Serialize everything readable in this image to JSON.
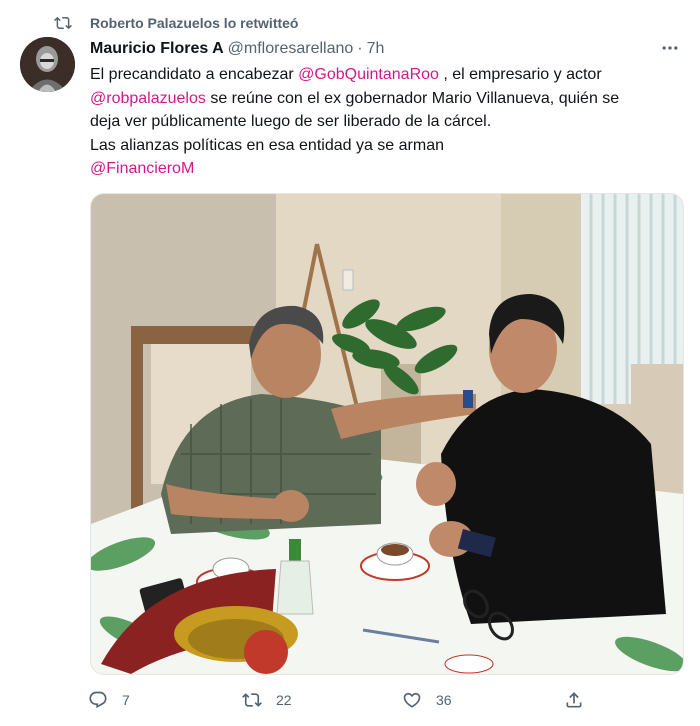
{
  "retweet": {
    "text": "Roberto Palazuelos lo retwitteó",
    "icon": "retweet-icon"
  },
  "author": {
    "name": "Mauricio Flores A",
    "handle": "@mfloresarellano",
    "separator": "·",
    "time": "7h"
  },
  "more_icon": "more-options-icon",
  "body": {
    "l1_text": "El precandidato a encabezar ",
    "l1_mention": "@GobQuintanaRoo",
    "l1_rest": " , el empresario y actor",
    "l2_mention": "@robpalazuelos",
    "l2_rest": " se reúne con el ex gobernador Mario Villanueva, quién se",
    "l3": "deja ver públicamente luego de ser liberado de la cárcel.",
    "l4": "Las alianzas políticas en esa entidad ya se arman",
    "l5_mention": "@FinancieroM"
  },
  "colors": {
    "mention": "#d4178b",
    "secondary": "#536471",
    "text": "#0f1419"
  },
  "actions": {
    "reply": {
      "icon": "reply-icon",
      "count": "7"
    },
    "retweet": {
      "icon": "retweet-icon",
      "count": "22"
    },
    "like": {
      "icon": "heart-icon",
      "count": "36"
    },
    "share": {
      "icon": "share-icon"
    }
  }
}
